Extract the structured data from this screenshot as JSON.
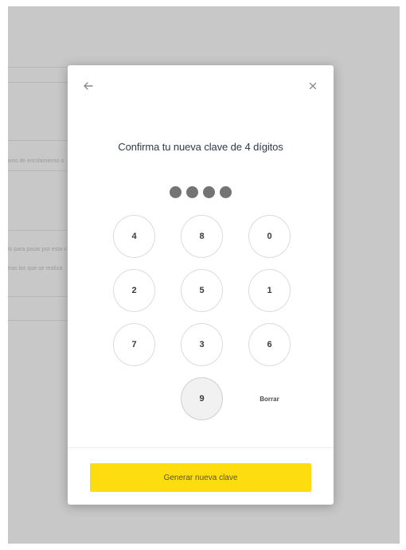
{
  "colors": {
    "accent": "#fddd0f",
    "overlay": "#c8c8c8",
    "text": "#30394a"
  },
  "background": {
    "text_1": "ivos de enrolamiento o",
    "text_2": "lo para pasar por esta v",
    "text_3": "tras las que se realiza"
  },
  "modal": {
    "back_icon": "arrow-left-icon",
    "close_icon": "close-icon",
    "title": "Confirma tu nueva clave de 4 dígitos",
    "entered_digits": 4,
    "keys": [
      "4",
      "8",
      "0",
      "2",
      "5",
      "1",
      "7",
      "3",
      "6",
      "9"
    ],
    "delete_label": "Borrar",
    "submit_label": "Generar nueva clave"
  }
}
